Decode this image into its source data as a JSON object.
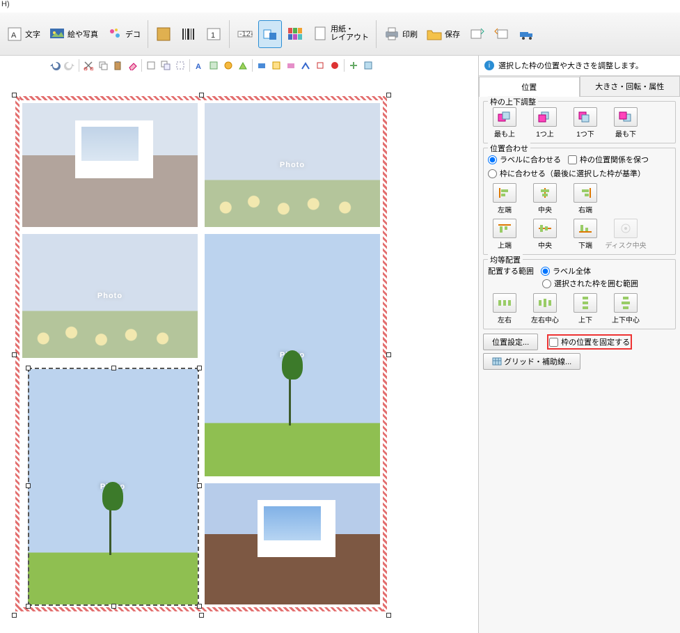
{
  "title_fragment": "H)",
  "toolbar": {
    "text": "文字",
    "photo": "絵や写真",
    "deco": "デコ",
    "paper": "用紙・\nレイアウト",
    "print": "印刷",
    "save": "保存"
  },
  "panel": {
    "info": "選択した枠の位置や大きさを調整します。",
    "tabs": {
      "pos": "位置",
      "size": "大きさ・回転・属性"
    },
    "g1": {
      "title": "枠の上下調整",
      "top": "最も上",
      "up": "1つ上",
      "down": "1つ下",
      "bottom": "最も下"
    },
    "g2": {
      "title": "位置合わせ",
      "r1": "ラベルに合わせる",
      "c1": "枠の位置関係を保つ",
      "r2": "枠に合わせる（最後に選択した枠が基準）",
      "left": "左端",
      "hcent": "中央",
      "right": "右端",
      "top": "上端",
      "vcent": "中央",
      "bot": "下端",
      "disc": "ディスク中央"
    },
    "g3": {
      "title": "均等配置",
      "range": "配置する範囲",
      "rA": "ラベル全体",
      "rB": "選択された枠を囲む範囲",
      "h": "左右",
      "hc": "左右中心",
      "v": "上下",
      "vc": "上下中心"
    },
    "posbtn": "位置設定...",
    "lock": "枠の位置を固定する",
    "grid": "グリッド・補助線..."
  },
  "placeholder": "Photo"
}
